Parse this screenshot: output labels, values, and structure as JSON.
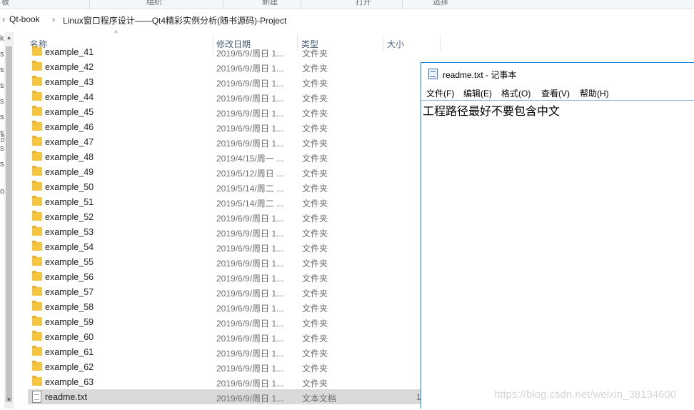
{
  "ribbon": {
    "groups": [
      "板",
      "组织",
      "新建",
      "打开",
      "选择"
    ]
  },
  "address": {
    "crumbs": [
      "Qt-book",
      "Linux窗口程序设计——Qt4精彩实例分析(随书源码)-Project"
    ]
  },
  "nav_pane": {
    "fragments": [
      "k",
      "s",
      "s",
      "s",
      "s",
      "s",
      "s",
      "s",
      "s",
      "员",
      "o"
    ]
  },
  "columns": {
    "name": "名称",
    "date": "修改日期",
    "type": "类型",
    "size": "大小"
  },
  "files": [
    {
      "name": "example_41",
      "date": "2019/6/9/周日 1...",
      "type": "文件夹",
      "kind": "folder"
    },
    {
      "name": "example_42",
      "date": "2019/6/9/周日 1...",
      "type": "文件夹",
      "kind": "folder"
    },
    {
      "name": "example_43",
      "date": "2019/6/9/周日 1...",
      "type": "文件夹",
      "kind": "folder"
    },
    {
      "name": "example_44",
      "date": "2019/6/9/周日 1...",
      "type": "文件夹",
      "kind": "folder"
    },
    {
      "name": "example_45",
      "date": "2019/6/9/周日 1...",
      "type": "文件夹",
      "kind": "folder"
    },
    {
      "name": "example_46",
      "date": "2019/6/9/周日 1...",
      "type": "文件夹",
      "kind": "folder"
    },
    {
      "name": "example_47",
      "date": "2019/6/9/周日 1...",
      "type": "文件夹",
      "kind": "folder"
    },
    {
      "name": "example_48",
      "date": "2019/4/15/周一 ...",
      "type": "文件夹",
      "kind": "folder"
    },
    {
      "name": "example_49",
      "date": "2019/5/12/周日 ...",
      "type": "文件夹",
      "kind": "folder"
    },
    {
      "name": "example_50",
      "date": "2019/5/14/周二 ...",
      "type": "文件夹",
      "kind": "folder"
    },
    {
      "name": "example_51",
      "date": "2019/5/14/周二 ...",
      "type": "文件夹",
      "kind": "folder"
    },
    {
      "name": "example_52",
      "date": "2019/6/9/周日 1...",
      "type": "文件夹",
      "kind": "folder"
    },
    {
      "name": "example_53",
      "date": "2019/6/9/周日 1...",
      "type": "文件夹",
      "kind": "folder"
    },
    {
      "name": "example_54",
      "date": "2019/6/9/周日 1...",
      "type": "文件夹",
      "kind": "folder"
    },
    {
      "name": "example_55",
      "date": "2019/6/9/周日 1...",
      "type": "文件夹",
      "kind": "folder"
    },
    {
      "name": "example_56",
      "date": "2019/6/9/周日 1...",
      "type": "文件夹",
      "kind": "folder"
    },
    {
      "name": "example_57",
      "date": "2019/6/9/周日 1...",
      "type": "文件夹",
      "kind": "folder"
    },
    {
      "name": "example_58",
      "date": "2019/6/9/周日 1...",
      "type": "文件夹",
      "kind": "folder"
    },
    {
      "name": "example_59",
      "date": "2019/6/9/周日 1...",
      "type": "文件夹",
      "kind": "folder"
    },
    {
      "name": "example_60",
      "date": "2019/6/9/周日 1...",
      "type": "文件夹",
      "kind": "folder"
    },
    {
      "name": "example_61",
      "date": "2019/6/9/周日 1...",
      "type": "文件夹",
      "kind": "folder"
    },
    {
      "name": "example_62",
      "date": "2019/6/9/周日 1...",
      "type": "文件夹",
      "kind": "folder"
    },
    {
      "name": "example_63",
      "date": "2019/6/9/周日 1...",
      "type": "文件夹",
      "kind": "folder"
    },
    {
      "name": "readme.txt",
      "date": "2019/6/9/周日 1...",
      "type": "文本文档",
      "size": "1",
      "kind": "text",
      "selected": true
    }
  ],
  "notepad": {
    "title": "readme.txt - 记事本",
    "menu": [
      "文件(F)",
      "编辑(E)",
      "格式(O)",
      "查看(V)",
      "帮助(H)"
    ],
    "content": "工程路径最好不要包含中文"
  },
  "watermark": "https://blog.csdn.net/weixin_38134600"
}
